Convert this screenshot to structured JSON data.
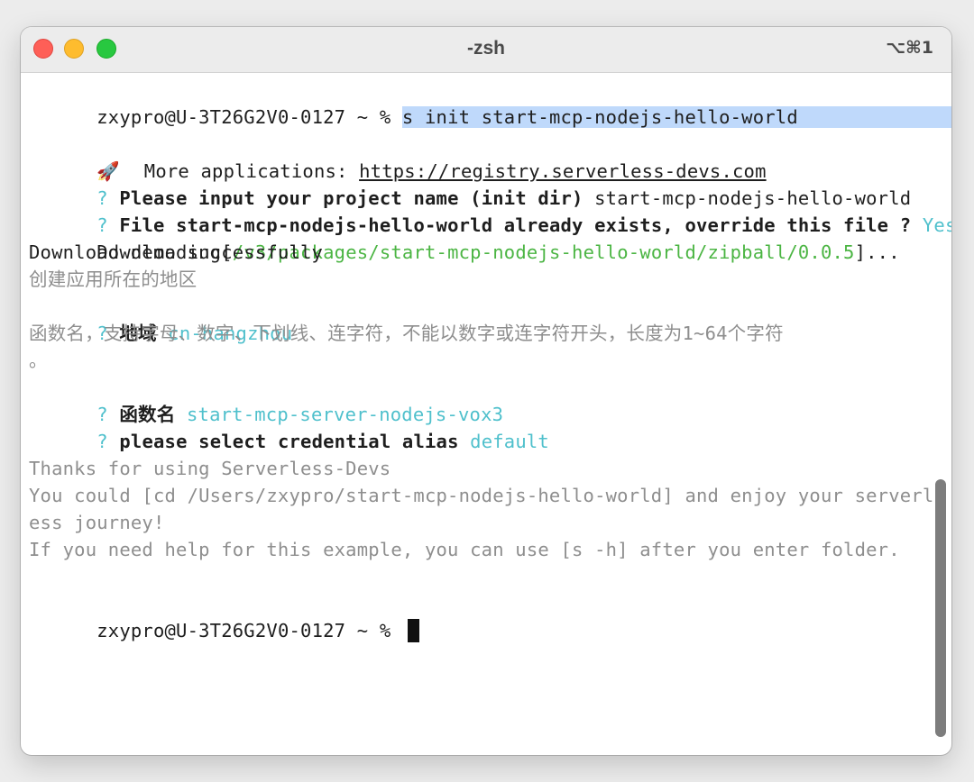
{
  "window": {
    "title": "-zsh",
    "shortcut": "⌥⌘1"
  },
  "terminal": {
    "prompt": "zxypro@U-3T26G2V0-0127 ~ % ",
    "command": "s init start-mcp-nodejs-hello-world",
    "rocket": "🚀",
    "more_apps_label": " More applications: ",
    "more_apps_url": "https://registry.serverless-devs.com",
    "q_mark": "? ",
    "q1_label": "Please input your project name (init dir)",
    "q1_value": " start-mcp-nodejs-hello-world",
    "q2_label": "File start-mcp-nodejs-hello-world already exists, override this file ?",
    "q2_value": " Yes",
    "download_prefix": "Downloading[",
    "download_path": "/v3/packages/start-mcp-nodejs-hello-world/zipball/0.0.5",
    "download_suffix": "]...",
    "download_success": "Download demo successfully",
    "region_hint": "创建应用所在的地区",
    "q3_label": "地域",
    "q3_value": " cn-hangzhou",
    "fn_hint": "函数名，支持字母、数字、下划线、连字符，不能以数字或连字符开头，长度为1~64个字符",
    "fn_hint_end": "。",
    "q4_label": "函数名",
    "q4_value": " start-mcp-server-nodejs-vox3",
    "q5_label": "please select credential alias",
    "q5_value": " default",
    "thanks": "Thanks for using Serverless-Devs",
    "cd_line_1": "You could [cd /Users/zxypro/start-mcp-nodejs-hello-world] and enjoy your serverl",
    "cd_line_2": "ess journey!",
    "help_line": "If you need help for this example, you can use [s -h] after you enter folder.",
    "final_prompt": "zxypro@U-3T26G2V0-0127 ~ % "
  },
  "colors": {
    "accent_cyan": "#4fc0cc",
    "path_green": "#4bb543",
    "hint_gray": "#8e8e8e",
    "selection": "#bfd9fb"
  }
}
